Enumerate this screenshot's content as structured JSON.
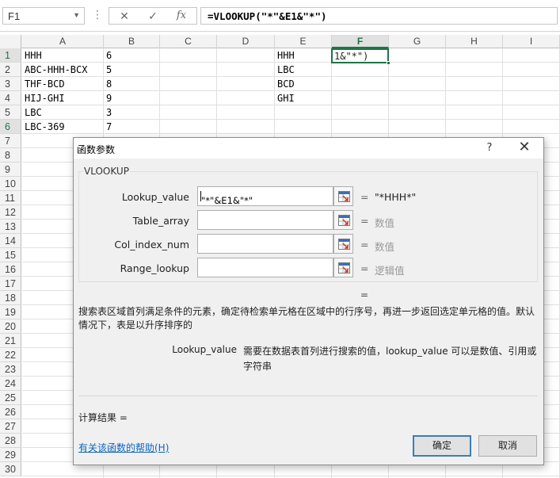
{
  "formula_bar": {
    "name_box": "F1",
    "cancel_icon": "✕",
    "enter_icon": "✓",
    "fx_label": "fx",
    "formula": "=VLOOKUP(\"*\"&E1&\"*\")"
  },
  "sheet": {
    "columns": [
      "A",
      "B",
      "C",
      "D",
      "E",
      "F",
      "G",
      "H",
      "I"
    ],
    "active_column": "F",
    "rows": [
      "1",
      "2",
      "3",
      "4",
      "5",
      "6",
      "7",
      "8",
      "9",
      "10",
      "11",
      "12",
      "13",
      "14",
      "15",
      "16",
      "17",
      "18",
      "19",
      "20",
      "21",
      "22",
      "23",
      "24",
      "25",
      "26",
      "27",
      "28",
      "29",
      "30"
    ],
    "active_rows": [
      "1",
      "6"
    ],
    "col_a": [
      "HHH",
      "ABC-HHH-BCX",
      "THF-BCD",
      "HIJ-GHI",
      "LBC",
      "LBC-369"
    ],
    "col_b": [
      "6",
      "5",
      "8",
      "9",
      "3",
      "7"
    ],
    "col_e": [
      "HHH",
      "LBC",
      "BCD",
      "GHI"
    ],
    "active_cell_text": "1&\"*\")"
  },
  "dialog": {
    "title": "函数参数",
    "help_glyph": "?",
    "close_glyph": "✕",
    "function_name": "VLOOKUP",
    "args": [
      {
        "label": "Lookup_value",
        "value": "\"*\"&E1&\"*\"",
        "equals": "=",
        "result": "\"*HHH*\""
      },
      {
        "label": "Table_array",
        "value": "",
        "equals": "=",
        "result": "数值"
      },
      {
        "label": "Col_index_num",
        "value": "",
        "equals": "=",
        "result": "数值"
      },
      {
        "label": "Range_lookup",
        "value": "",
        "equals": "=",
        "result": "逻辑值"
      }
    ],
    "function_result_eq": "=",
    "description": "搜索表区域首列满足条件的元素，确定待检索单元格在区域中的行序号，再进一步返回选定单元格的值。默认情况下，表是以升序排序的",
    "param_name": "Lookup_value",
    "param_description": "需要在数据表首列进行搜索的值，lookup_value 可以是数值、引用或字符串",
    "result_label": "计算结果 =",
    "help_link": "有关该函数的帮助(H)",
    "ok_label": "确定",
    "cancel_label": "取消"
  }
}
